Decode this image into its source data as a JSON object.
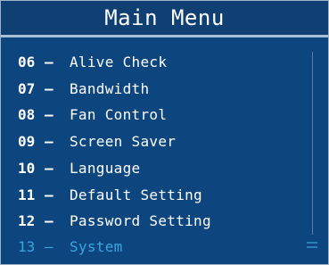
{
  "menu": {
    "title": "Main Menu",
    "items": [
      {
        "num": "06",
        "dash": "–",
        "label": "Alive Check"
      },
      {
        "num": "07",
        "dash": "–",
        "label": "Bandwidth"
      },
      {
        "num": "08",
        "dash": "–",
        "label": "Fan Control"
      },
      {
        "num": "09",
        "dash": "–",
        "label": "Screen Saver"
      },
      {
        "num": "10",
        "dash": "–",
        "label": "Language"
      },
      {
        "num": "11",
        "dash": "–",
        "label": "Default Setting"
      },
      {
        "num": "12",
        "dash": "–",
        "label": "Password Setting"
      },
      {
        "num": "13",
        "dash": "–",
        "label": "System"
      }
    ],
    "selected_index": 7
  },
  "colors": {
    "background": "#0d467e",
    "title_separator": "#a9bfd4",
    "text": "#ffffff",
    "selected_text": "#39a6de"
  }
}
